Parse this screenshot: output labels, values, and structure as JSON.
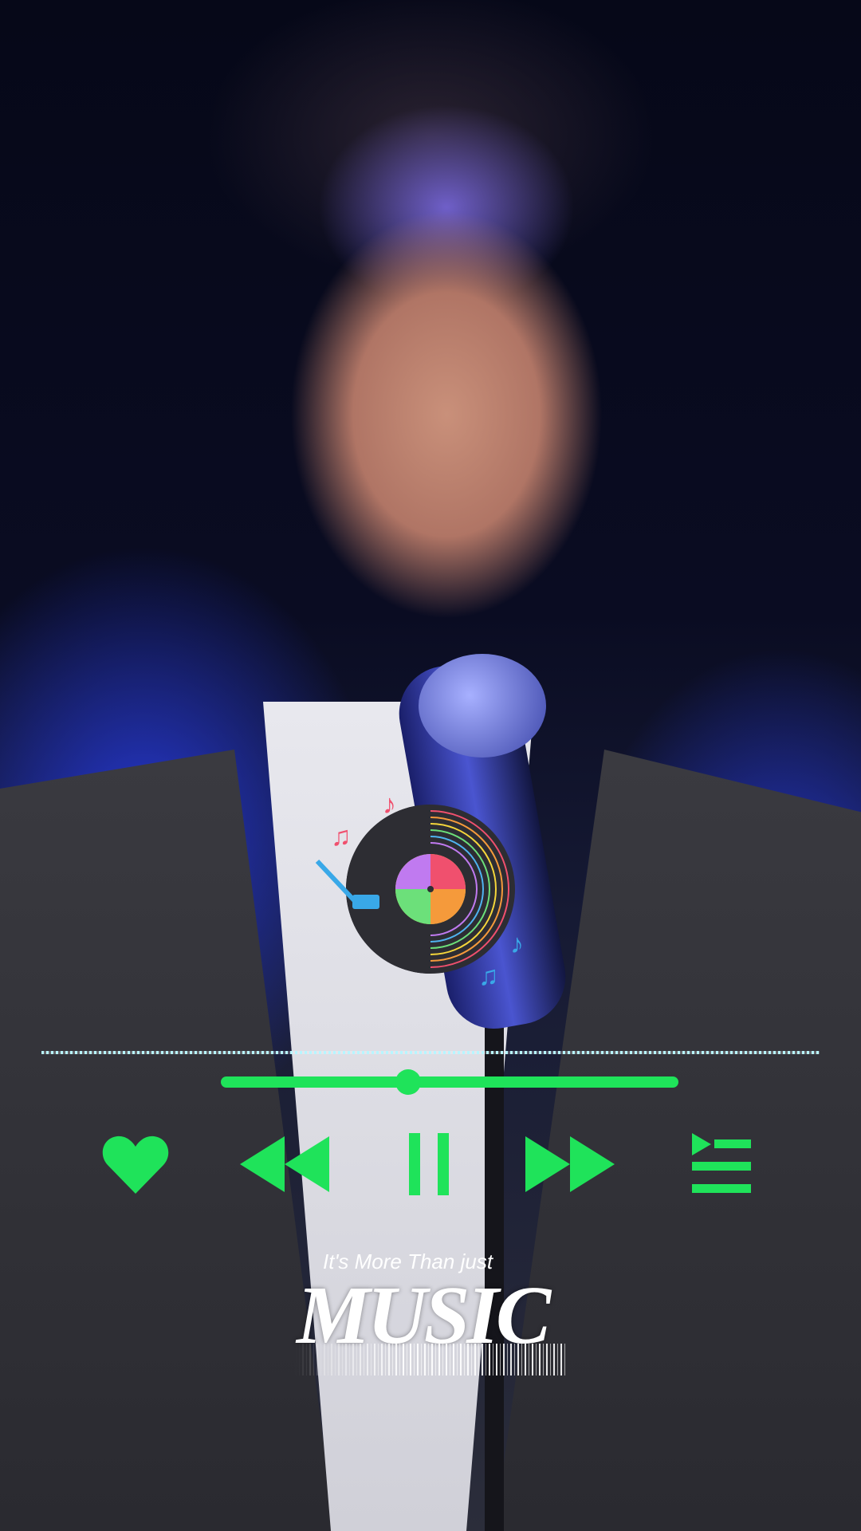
{
  "background": {
    "description_icon": "singer-photo"
  },
  "player": {
    "progress_percent": 41,
    "accent_color": "#1fe35a",
    "controls": {
      "like": {
        "icon": "heart-icon"
      },
      "previous": {
        "icon": "rewind-icon"
      },
      "play_pause": {
        "icon": "pause-icon",
        "state": "playing"
      },
      "next": {
        "icon": "fast-forward-icon"
      },
      "playlist": {
        "icon": "playlist-icon"
      }
    }
  },
  "tagline": {
    "small": "It's More Than  just",
    "big": "MUSIC"
  },
  "notes": {
    "note1": "♪",
    "note2": "♫",
    "note3": "♪",
    "note4": "♫"
  }
}
